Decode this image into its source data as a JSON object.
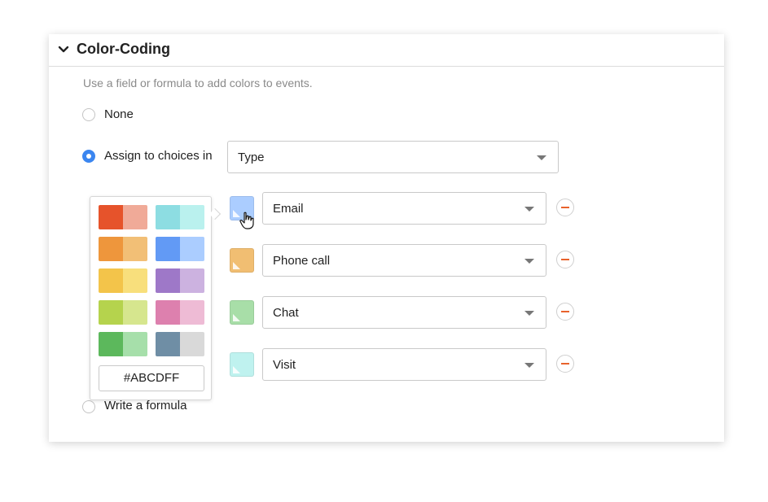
{
  "section": {
    "title": "Color-Coding",
    "description": "Use a field or formula to add colors to events."
  },
  "options": {
    "none_label": "None",
    "assign_label": "Assign to choices in",
    "formula_label": "Write a formula",
    "selected": "assign"
  },
  "field_select": {
    "value": "Type"
  },
  "choices": [
    {
      "label": "Email",
      "color": "#abcdff"
    },
    {
      "label": "Phone call",
      "color": "#f1be72"
    },
    {
      "label": "Chat",
      "color": "#a8dea8"
    },
    {
      "label": "Visit",
      "color": "#bff2ef"
    }
  ],
  "palette": {
    "rows": [
      [
        [
          "#e6532b",
          "#f0aa98"
        ],
        [
          "#8ddde2",
          "#baf1ee"
        ]
      ],
      [
        [
          "#ee963c",
          "#f2bf76"
        ],
        [
          "#629af5",
          "#abcdff"
        ]
      ],
      [
        [
          "#f3c44a",
          "#f8df7c"
        ],
        [
          "#9e78c8",
          "#ccb2e0"
        ]
      ],
      [
        [
          "#b5d34d",
          "#d6e68e"
        ],
        [
          "#dd80ae",
          "#eebbd5"
        ]
      ],
      [
        [
          "#5cb85c",
          "#a6dfaa"
        ],
        [
          "#6f8ea5",
          "#d9d9d9"
        ]
      ]
    ],
    "hex_value": "#ABCDFF"
  },
  "colors": {
    "accent": "#3b86f0",
    "remove": "#e8622c"
  }
}
